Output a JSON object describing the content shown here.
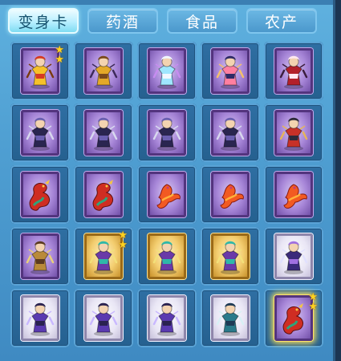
{
  "tabs": [
    {
      "label": "变身卡",
      "active": true
    },
    {
      "label": "药酒",
      "active": false
    },
    {
      "label": "食品",
      "active": false
    },
    {
      "label": "农产",
      "active": false
    }
  ],
  "colors": {
    "panel_bg": "#4f9fd2",
    "slot_bg": "#2f6fa3",
    "tab_active": "#b8efff",
    "tab_inactive": "#5aa7d8",
    "card_purple": "#a685d7",
    "card_gold": "#f3cd6f",
    "card_white": "#e9e6f5",
    "star": "#ffd21f"
  },
  "inventory": [
    {
      "frame": "purple",
      "icon": "golden-lion-figure-icon",
      "stars": 2
    },
    {
      "frame": "purple",
      "icon": "golden-beast-figure-icon",
      "stars": 0
    },
    {
      "frame": "purple",
      "icon": "cyan-spirit-figure-icon",
      "stars": 0
    },
    {
      "frame": "purple",
      "icon": "pink-warrior-figure-icon",
      "stars": 0
    },
    {
      "frame": "purple",
      "icon": "red-fox-spirit-figure-icon",
      "stars": 0
    },
    {
      "frame": "purple",
      "icon": "dark-armored-warrior-icon",
      "stars": 0
    },
    {
      "frame": "purple",
      "icon": "dark-armored-warrior-icon",
      "stars": 0
    },
    {
      "frame": "purple",
      "icon": "dark-armored-warrior-icon",
      "stars": 0
    },
    {
      "frame": "purple",
      "icon": "dark-armored-warrior-icon",
      "stars": 0
    },
    {
      "frame": "purple",
      "icon": "red-demon-warrior-icon",
      "stars": 0
    },
    {
      "frame": "purple",
      "icon": "red-dragon-icon",
      "stars": 0
    },
    {
      "frame": "purple",
      "icon": "red-dragon-icon",
      "stars": 0
    },
    {
      "frame": "purple",
      "icon": "fire-phoenix-icon",
      "stars": 0
    },
    {
      "frame": "purple",
      "icon": "fire-phoenix-icon",
      "stars": 0
    },
    {
      "frame": "purple",
      "icon": "fire-phoenix-icon",
      "stars": 0
    },
    {
      "frame": "purple",
      "icon": "bronze-general-icon",
      "stars": 0
    },
    {
      "frame": "gold",
      "icon": "purple-sage-figure-icon",
      "stars": 2
    },
    {
      "frame": "gold",
      "icon": "purple-sage-figure-icon",
      "stars": 0
    },
    {
      "frame": "gold",
      "icon": "purple-sage-figure-icon",
      "stars": 0
    },
    {
      "frame": "white",
      "icon": "dark-sorcerer-figure-icon",
      "stars": 0
    },
    {
      "frame": "white",
      "icon": "purple-ninja-figure-icon",
      "stars": 0
    },
    {
      "frame": "white",
      "icon": "purple-ninja-figure-icon",
      "stars": 0
    },
    {
      "frame": "white",
      "icon": "purple-ninja-figure-icon",
      "stars": 0
    },
    {
      "frame": "white",
      "icon": "teal-knight-figure-icon",
      "stars": 0
    },
    {
      "frame": "purple",
      "icon": "red-dragon-icon",
      "stars": 2,
      "glow": true
    }
  ]
}
